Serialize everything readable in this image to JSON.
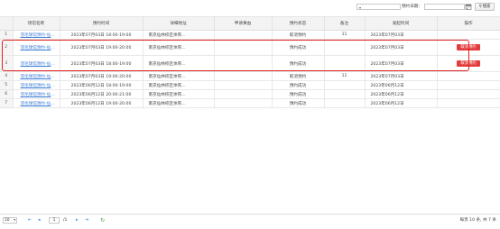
{
  "toolbar": {
    "status_select_value": "",
    "date_label": "预约日期：",
    "date_value": "",
    "search_label": "搜索"
  },
  "table": {
    "headers": [
      "",
      "场馆名称",
      "预约时间",
      "详细地址",
      "申请事由",
      "预约状态",
      "备注",
      "发起时间",
      "操作"
    ],
    "rows": [
      {
        "no": "1",
        "name": "羽毛球馆预约-仙林...",
        "time": "2023年07月03日 18:00-19:00",
        "addr": "南京仙林校区体育...",
        "reason": "",
        "status": "取消预约",
        "note": "11",
        "created": "2023年07月03日",
        "action": ""
      },
      {
        "no": "2",
        "name": "羽毛球馆预约-仙林...",
        "time": "2023年07月03日 19:00-20:00",
        "addr": "南京仙林校区体育...",
        "reason": "",
        "status": "预约成功",
        "note": "",
        "created": "2023年07月03日",
        "action": "取消预约"
      },
      {
        "no": "3",
        "name": "羽毛球馆预约-仙林...",
        "time": "2023年07月03日 18:00-19:00",
        "addr": "南京仙林校区体育...",
        "reason": "",
        "status": "预约成功",
        "note": "",
        "created": "2023年07月03日",
        "action": "取消预约"
      },
      {
        "no": "4",
        "name": "羽毛球馆预约-仙林...",
        "time": "2023年07月03日 19:00-20:00",
        "addr": "南京仙林校区体育...",
        "reason": "",
        "status": "取消预约",
        "note": "11",
        "created": "2023年07月03日",
        "action": ""
      },
      {
        "no": "5",
        "name": "羽毛球馆预约-仙林...",
        "time": "2023年06月12日 18:00-19:00",
        "addr": "南京仙林校区体育...",
        "reason": "",
        "status": "预约成功",
        "note": "",
        "created": "2023年06月12日",
        "action": ""
      },
      {
        "no": "6",
        "name": "羽毛球馆预约-仙林...",
        "time": "2023年06月12日 20:00-21:00",
        "addr": "南京仙林校区体育...",
        "reason": "",
        "status": "预约成功",
        "note": "",
        "created": "2023年06月12日",
        "action": ""
      },
      {
        "no": "7",
        "name": "羽毛球馆预约-仙林...",
        "time": "2023年06月12日 19:00-20:00",
        "addr": "南京仙林校区体育...",
        "reason": "",
        "status": "预约成功",
        "note": "",
        "created": "2023年06月12日",
        "action": ""
      }
    ]
  },
  "pager": {
    "page_size": "10",
    "current_page": "1",
    "total_pages": "/1",
    "summary": "每页 10 条, 共 7 条"
  },
  "colors": {
    "accent": "#e23c3c",
    "link": "#3e7fd6",
    "highlight": "#e02020"
  }
}
